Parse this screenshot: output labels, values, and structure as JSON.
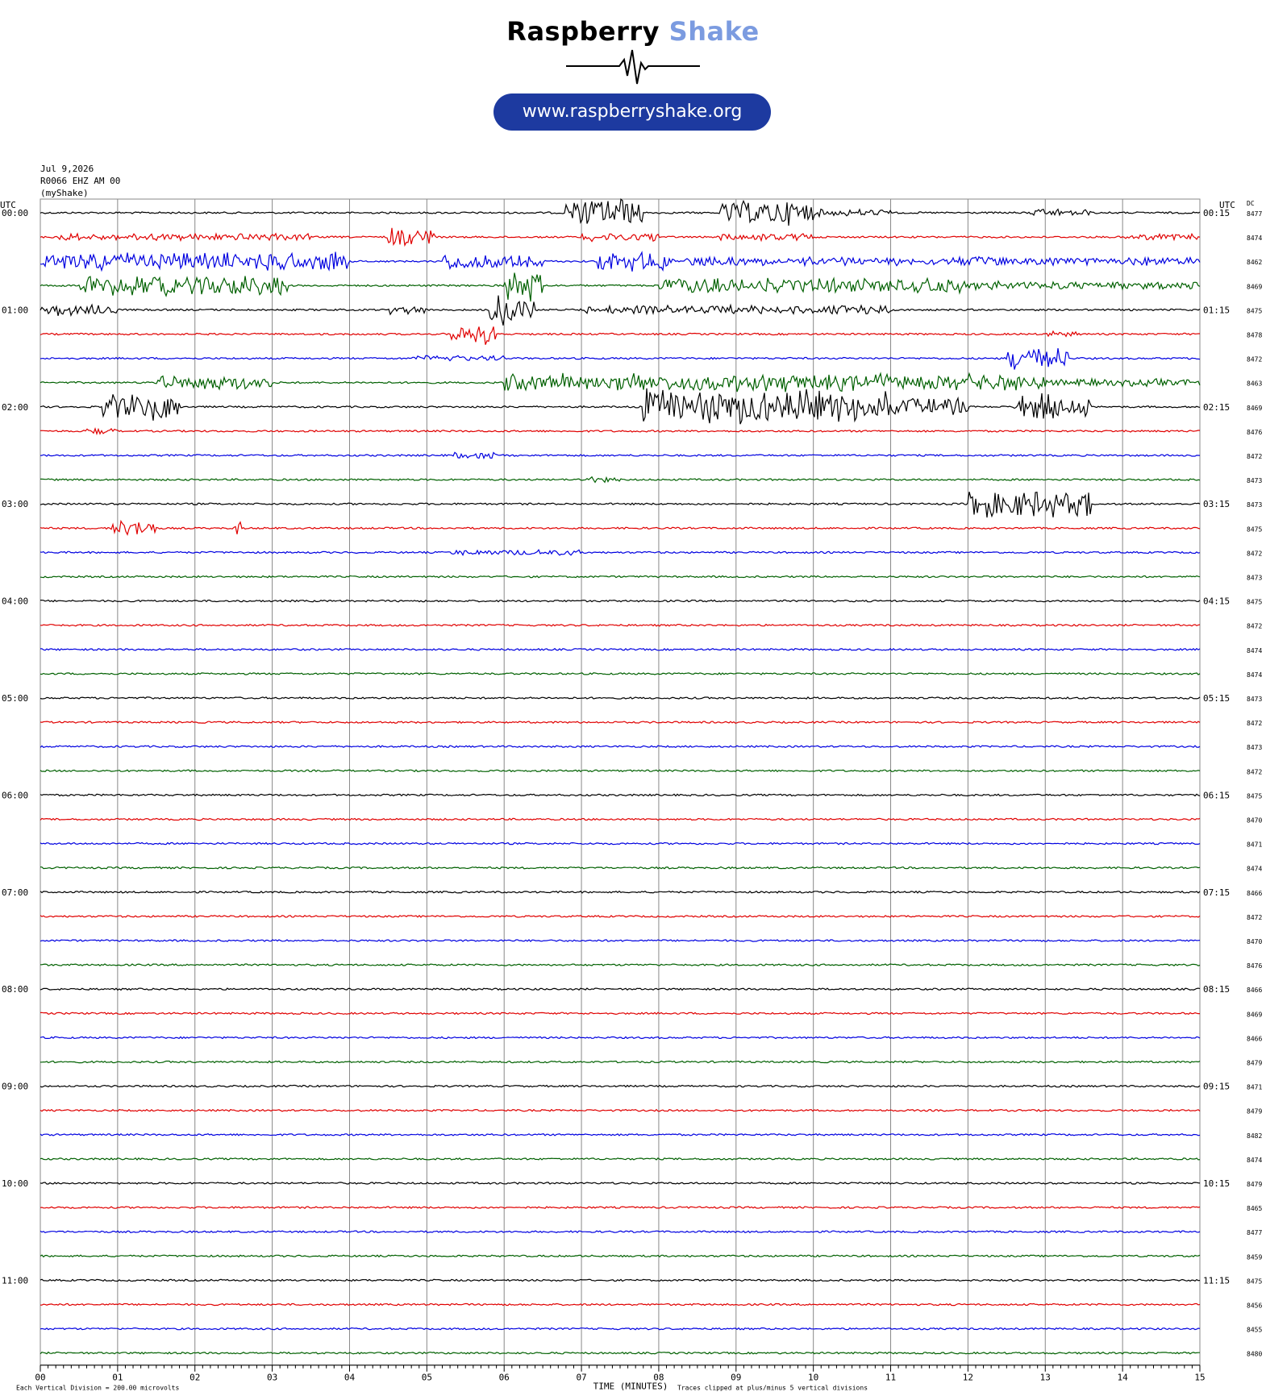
{
  "brand": {
    "name_main": "Raspberry",
    "name_accent": "Shake",
    "url": "www.raspberryshake.org",
    "accent_color": "#7b9be0",
    "url_bg_color": "#1d3aa0"
  },
  "meta": {
    "date": "Jul 9,2026",
    "station": "R0066 EHZ AM 00",
    "network": "(myShake)"
  },
  "chart_data": {
    "type": "line",
    "chart_kind": "helicorder",
    "left_axis_label": "UTC",
    "right_axis_label": "UTC",
    "dc_label": "DC",
    "xlabel": "TIME (MINUTES)",
    "xlim": [
      0,
      15
    ],
    "x_ticks": [
      "00",
      "01",
      "02",
      "03",
      "04",
      "05",
      "06",
      "07",
      "08",
      "09",
      "10",
      "11",
      "12",
      "13",
      "14",
      "15"
    ],
    "trace_colors": [
      "#000000",
      "#e00000",
      "#0000e0",
      "#006000"
    ],
    "traces": [
      {
        "left": "00:00",
        "right": "00:15",
        "dc": "8477"
      },
      {
        "left": "",
        "right": "",
        "dc": "8474"
      },
      {
        "left": "",
        "right": "",
        "dc": "8462"
      },
      {
        "left": "",
        "right": "",
        "dc": "8469"
      },
      {
        "left": "01:00",
        "right": "01:15",
        "dc": "8475"
      },
      {
        "left": "",
        "right": "",
        "dc": "8478"
      },
      {
        "left": "",
        "right": "",
        "dc": "8472"
      },
      {
        "left": "",
        "right": "",
        "dc": "8463"
      },
      {
        "left": "02:00",
        "right": "02:15",
        "dc": "8469"
      },
      {
        "left": "",
        "right": "",
        "dc": "8476"
      },
      {
        "left": "",
        "right": "",
        "dc": "8472"
      },
      {
        "left": "",
        "right": "",
        "dc": "8473"
      },
      {
        "left": "03:00",
        "right": "03:15",
        "dc": "8473"
      },
      {
        "left": "",
        "right": "",
        "dc": "8475"
      },
      {
        "left": "",
        "right": "",
        "dc": "8472"
      },
      {
        "left": "",
        "right": "",
        "dc": "8473"
      },
      {
        "left": "04:00",
        "right": "04:15",
        "dc": "8475"
      },
      {
        "left": "",
        "right": "",
        "dc": "8472"
      },
      {
        "left": "",
        "right": "",
        "dc": "8474"
      },
      {
        "left": "",
        "right": "",
        "dc": "8474"
      },
      {
        "left": "05:00",
        "right": "05:15",
        "dc": "8473"
      },
      {
        "left": "",
        "right": "",
        "dc": "8472"
      },
      {
        "left": "",
        "right": "",
        "dc": "8473"
      },
      {
        "left": "",
        "right": "",
        "dc": "8472"
      },
      {
        "left": "06:00",
        "right": "06:15",
        "dc": "8475"
      },
      {
        "left": "",
        "right": "",
        "dc": "8470"
      },
      {
        "left": "",
        "right": "",
        "dc": "8471"
      },
      {
        "left": "",
        "right": "",
        "dc": "8474"
      },
      {
        "left": "07:00",
        "right": "07:15",
        "dc": "8466"
      },
      {
        "left": "",
        "right": "",
        "dc": "8472"
      },
      {
        "left": "",
        "right": "",
        "dc": "8470"
      },
      {
        "left": "",
        "right": "",
        "dc": "8476"
      },
      {
        "left": "08:00",
        "right": "08:15",
        "dc": "8466"
      },
      {
        "left": "",
        "right": "",
        "dc": "8469"
      },
      {
        "left": "",
        "right": "",
        "dc": "8466"
      },
      {
        "left": "",
        "right": "",
        "dc": "8479"
      },
      {
        "left": "09:00",
        "right": "09:15",
        "dc": "8471"
      },
      {
        "left": "",
        "right": "",
        "dc": "8479"
      },
      {
        "left": "",
        "right": "",
        "dc": "8482"
      },
      {
        "left": "",
        "right": "",
        "dc": "8474"
      },
      {
        "left": "10:00",
        "right": "10:15",
        "dc": "8479"
      },
      {
        "left": "",
        "right": "",
        "dc": "8465"
      },
      {
        "left": "",
        "right": "",
        "dc": "8477"
      },
      {
        "left": "",
        "right": "",
        "dc": "8459"
      },
      {
        "left": "11:00",
        "right": "11:15",
        "dc": "8475"
      },
      {
        "left": "",
        "right": "",
        "dc": "8456"
      },
      {
        "left": "",
        "right": "",
        "dc": "8455"
      },
      {
        "left": "",
        "right": "",
        "dc": "8480"
      }
    ],
    "footnote_left": "Each Vertical Division =  200.00 microvolts",
    "footnote_right": "Traces clipped at plus/minus 5 vertical divisions"
  }
}
